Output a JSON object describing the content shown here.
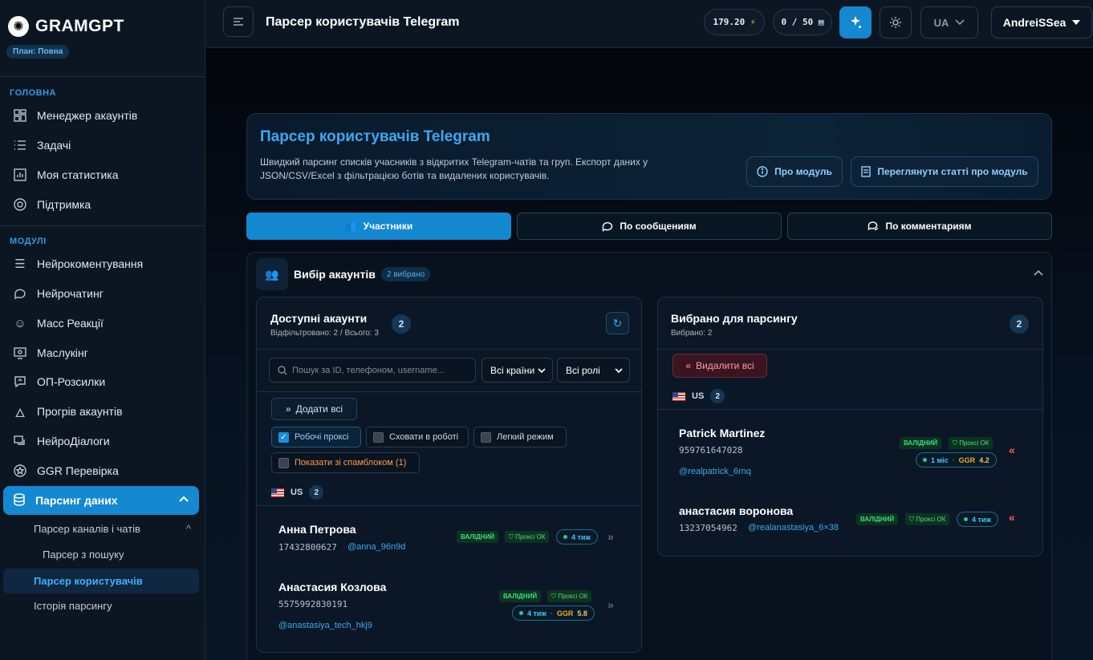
{
  "brand": {
    "name": "GRAMGPT",
    "plan": "План: Повна"
  },
  "sidebar": {
    "main_label": "ГОЛОВНА",
    "main_items": [
      {
        "label": "Менеджер акаунтів",
        "icon": "grid-icon"
      },
      {
        "label": "Задачі",
        "icon": "list-icon"
      },
      {
        "label": "Моя статистика",
        "icon": "bar-chart-icon"
      },
      {
        "label": "Підтримка",
        "icon": "lifebuoy-icon"
      }
    ],
    "modules_label": "МОДУЛІ",
    "module_items": [
      {
        "label": "Нейрокоментування",
        "icon": "comments-icon"
      },
      {
        "label": "Нейрочатинг",
        "icon": "chat-bubble-icon"
      },
      {
        "label": "Масс Реакції",
        "icon": "smile-icon"
      },
      {
        "label": "Маслукінг",
        "icon": "eye-monitor-icon"
      },
      {
        "label": "ОП-Розсилки",
        "icon": "send-message-icon"
      },
      {
        "label": "Прогрів акаунтів",
        "icon": "flame-icon"
      },
      {
        "label": "НейроДіалоги",
        "icon": "dialogs-icon"
      },
      {
        "label": "GGR Перевірка",
        "icon": "star-circle-icon"
      }
    ],
    "active_item": "Парсинг даних",
    "sub_group": "Парсер каналів і чатів",
    "sub_item": "Парсер з пошуку",
    "sub_active": "Парсер користувачів",
    "sub_history": "Історія парсингу"
  },
  "topbar": {
    "title": "Парсер користувачів Telegram",
    "balance": "179.20",
    "balance_icon": "⚡",
    "limit": "0 / 50",
    "lang": "UA",
    "user": "AndreiSSea"
  },
  "hero": {
    "title": "Парсер користувачів Telegram",
    "desc": "Швидкий парсинг списків учасників з відкритих Telegram-чатів та груп. Експорт даних у JSON/CSV/Excel з фільтрацією ботів та видалених користувачів.",
    "about_btn": "Про модуль",
    "articles_btn": "Переглянути статті про модуль"
  },
  "tabs": [
    "Участники",
    "По сообщениям",
    "По комментариям"
  ],
  "accounts": {
    "title": "Вибір акаунтів",
    "selected_badge": "2 вибрано",
    "available": {
      "title": "Доступні акаунти",
      "sub": "Відфільтровано: 2 / Всього: 3",
      "count": "2",
      "search_placeholder": "Пошук за ID, телефоном, username...",
      "country_select": "Всі країни",
      "role_select": "Всі ролі",
      "add_all": "Додати всі",
      "checks": [
        "Робочі проксі",
        "Сховати в роботі",
        "Легкий режим",
        "Показати зі спамблоком (1)"
      ],
      "country": "US",
      "country_count": "2",
      "list": [
        {
          "name": "Анна Петрова",
          "phone": "17432800627",
          "username": "@anna_96n9d",
          "status": "ВАЛІДНИЙ",
          "proxy": "Проксі ОК",
          "age": "4 тиж",
          "ggr": ""
        },
        {
          "name": "Анастасия Козлова",
          "phone": "5575992830191",
          "username": "@anastasiya_tech_hkj9",
          "status": "ВАЛІДНИЙ",
          "proxy": "Проксі ОК",
          "age": "4 тиж",
          "ggr": "5.8"
        }
      ]
    },
    "selected": {
      "title": "Вибрано для парсингу",
      "sub": "Вибрано: 2",
      "count": "2",
      "remove_all": "Видалити всі",
      "country": "US",
      "country_count": "2",
      "list": [
        {
          "name": "Patrick Martinez",
          "phone": "959761647028",
          "username": "@realpatrick_6rnq",
          "status": "ВАЛІДНИЙ",
          "proxy": "Проксі ОК",
          "age": "1 міс",
          "ggr": "4.2"
        },
        {
          "name": "анастасия воронова",
          "phone": "13237054962",
          "username": "@realanastasiya_6×38",
          "status": "ВАЛІДНИЙ",
          "proxy": "Проксі ОК",
          "age": "4 тиж",
          "ggr": ""
        }
      ]
    }
  },
  "labels": {
    "ggr": "GGR"
  },
  "colors": {
    "accent": "#1488d0",
    "valid": "#3ddc84",
    "ggr": "#f0a820",
    "danger": "#ff9aa8"
  }
}
